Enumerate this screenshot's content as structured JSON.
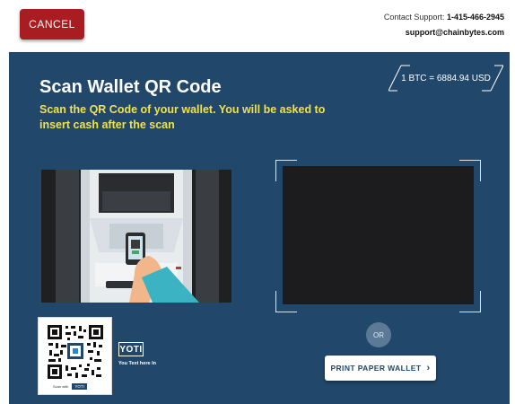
{
  "header": {
    "cancel_label": "CANCEL",
    "support_prefix": "Contact Support: ",
    "support_phone": "1-415-466-2945",
    "support_email": "support@chainbytes.com"
  },
  "rate": {
    "text": "1 BTC = 6884.94 USD"
  },
  "page": {
    "title": "Scan Wallet QR Code",
    "subtitle": "Scan the QR Code of your wallet. You will be asked to insert cash after the scan"
  },
  "or_label": "OR",
  "print_button": {
    "label": "PRINT PAPER WALLET",
    "icon": "chevron-right-icon"
  },
  "yoti": {
    "logo_text": "YOTI",
    "tagline": "You Text here In",
    "scan_with": "Scan with"
  },
  "colors": {
    "panel": "#21486b",
    "cancel": "#a91d22",
    "subtitle": "#f0e24a"
  }
}
